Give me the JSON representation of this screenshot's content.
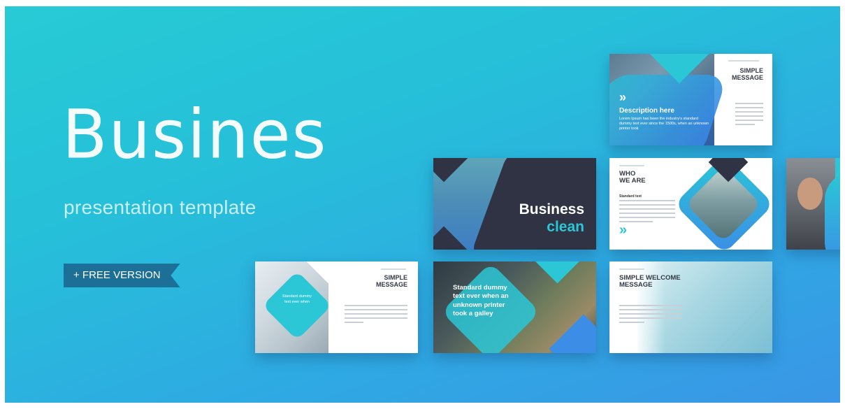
{
  "hero": {
    "title": "Busines",
    "subtitle": "presentation template",
    "badge": "+ FREE VERSION"
  },
  "slides": {
    "top_right": {
      "title_line1": "SIMPLE",
      "title_line2": "MESSAGE",
      "caption_title": "Description here",
      "caption_text": "Lorem Ipsum has been the industry's standard dummy text ever since the 1500s, when an unknown printer took"
    },
    "business_clean": {
      "word1": "Business",
      "word2": "clean"
    },
    "who_we_are": {
      "line1": "WHO",
      "line2": "WE ARE",
      "sub": "Standard text"
    },
    "bottom_left": {
      "title_line1": "SIMPLE",
      "title_line2": "MESSAGE",
      "badge_text": "Standard dummy text ever when"
    },
    "bottom_middle": {
      "text": "Standard dummy text ever when an unknown printer took a galley"
    },
    "bottom_right": {
      "title_line1": "SIMPLE WELCOME",
      "title_line2": "MESSAGE"
    }
  },
  "colors": {
    "accent": "#2bc7d6",
    "blue": "#3b8de6",
    "dark": "#2f3343",
    "ribbon": "#1c6f96"
  }
}
